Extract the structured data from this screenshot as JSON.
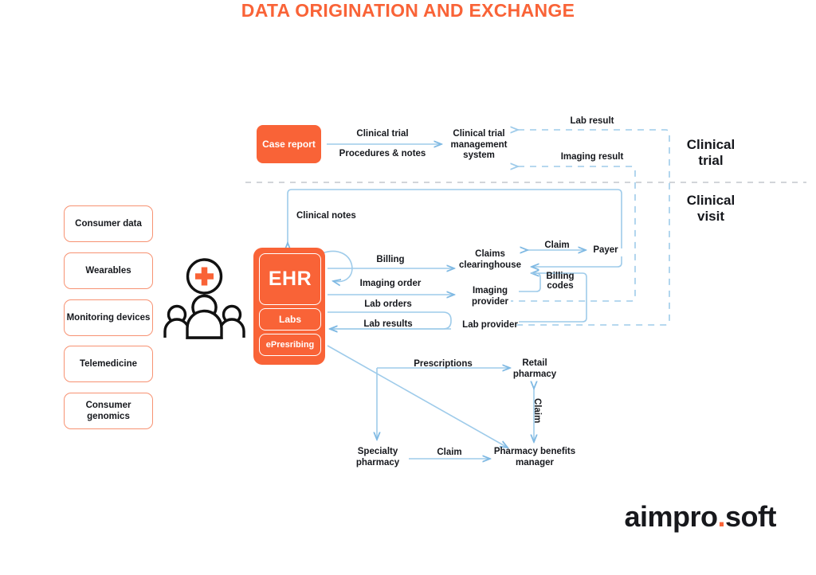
{
  "title": "DATA ORIGINATION AND EXCHANGE",
  "brand": {
    "name_left": "aimpro",
    "separator": ".",
    "name_right": "soft"
  },
  "colors": {
    "accent": "#f96337",
    "box_border": "#f79272",
    "wire": "#9ecbea",
    "divider": "#b8bcc2",
    "text": "#16181d"
  },
  "zones": [
    {
      "id": "clinical-trial",
      "line1": "Clinical",
      "line2": "trial"
    },
    {
      "id": "clinical-visit",
      "line1": "Clinical",
      "line2": "visit"
    }
  ],
  "sources": [
    {
      "id": "consumer-data",
      "label": "Consumer data"
    },
    {
      "id": "wearables",
      "label": "Wearables"
    },
    {
      "id": "monitoring-devices",
      "label": "Monitoring devices"
    },
    {
      "id": "telemedicine",
      "label": "Telemedicine"
    },
    {
      "id": "consumer-genomics",
      "label": "Consumer genomics"
    }
  ],
  "nodes": {
    "case_report": "Case report",
    "ctms": "Clinical trial management system",
    "ehr": "EHR",
    "labs": "Labs",
    "eprescribing": "ePresribing",
    "claims_clearinghouse": "Claims clearinghouse",
    "payer": "Payer",
    "imaging_provider": "Imaging provider",
    "lab_provider": "Lab provider",
    "retail_pharmacy": "Retail pharmacy",
    "specialty_pharmacy": "Specialty pharmacy",
    "pharmacy_benefits_manager": "Pharmacy benefits manager"
  },
  "edges": {
    "clinical_trial": "Clinical trial",
    "procedures_notes": "Procedures & notes",
    "lab_result": "Lab result",
    "imaging_result": "Imaging result",
    "clinical_notes": "Clinical notes",
    "billing": "Billing",
    "imaging_order": "Imaging order",
    "lab_orders": "Lab orders",
    "lab_results": "Lab results",
    "claim_payer": "Claim",
    "billing_codes": "Billing codes",
    "prescriptions": "Prescriptions",
    "claim_pbm_retail": "Claim",
    "claim_specialty": "Claim"
  }
}
